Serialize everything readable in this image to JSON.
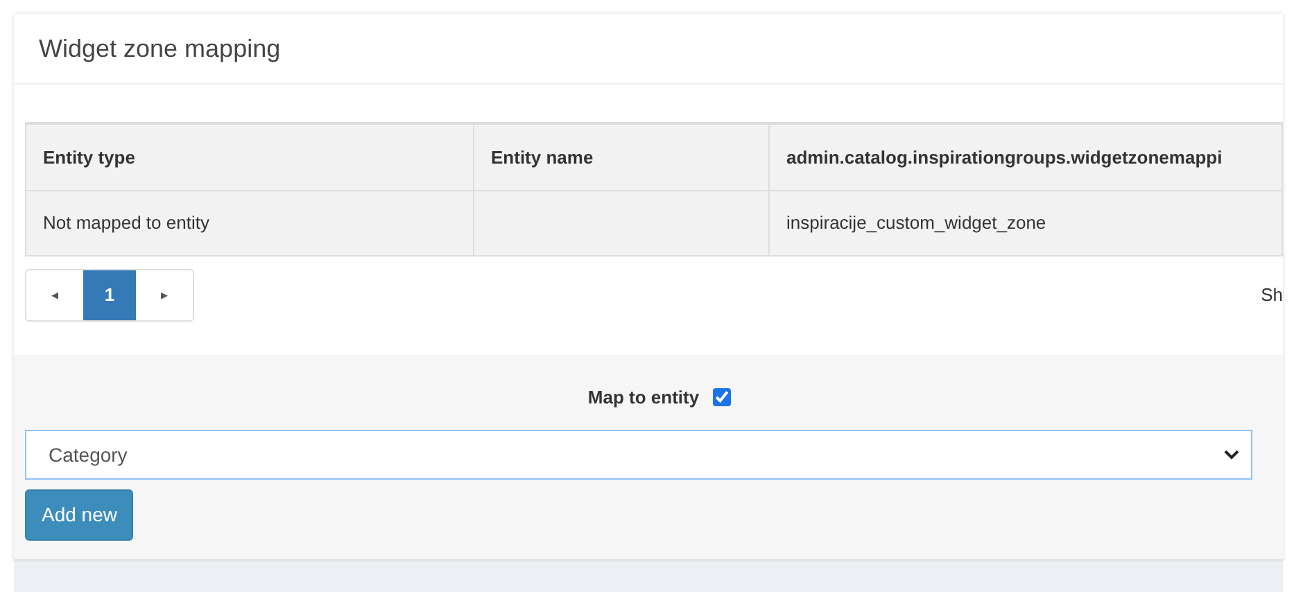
{
  "card": {
    "title": "Widget zone mapping"
  },
  "table": {
    "columns": [
      "Entity type",
      "Entity name",
      "admin.catalog.inspirationgroups.widgetzonemappi"
    ],
    "rows": [
      [
        "Not mapped to entity",
        "",
        "inspiracije_custom_widget_zone"
      ]
    ]
  },
  "pagination": {
    "prev": "◂",
    "pages": [
      {
        "label": "1",
        "selected": true
      }
    ],
    "next": "▸",
    "info": "Sh"
  },
  "form": {
    "checkbox": {
      "label": "Map to entity",
      "checked": true
    },
    "select": {
      "value": "Category"
    },
    "button": "Add new"
  }
}
